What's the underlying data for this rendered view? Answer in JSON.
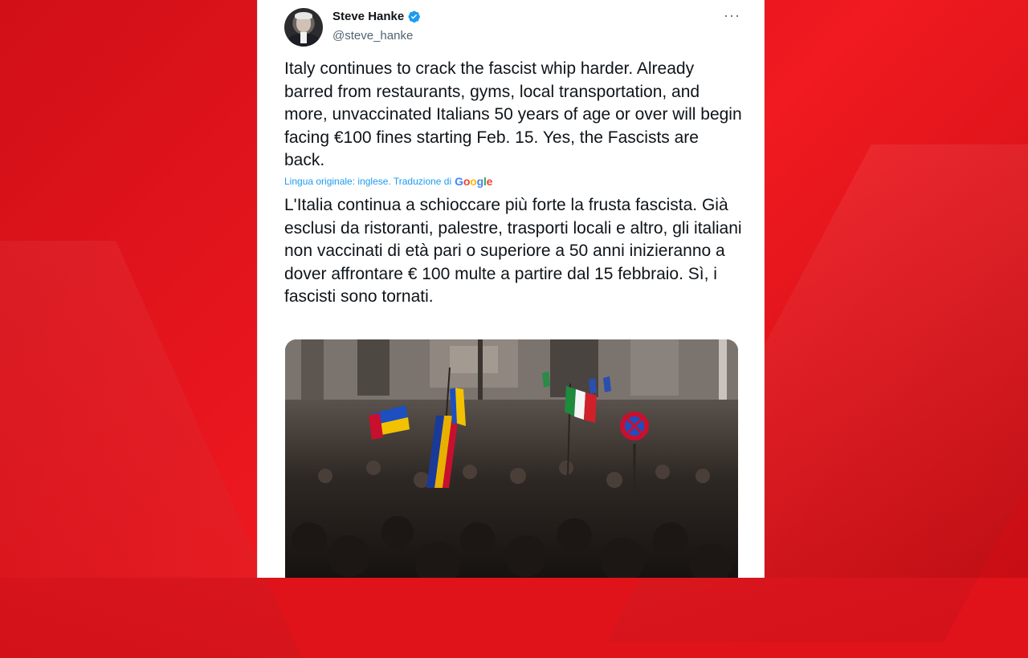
{
  "tweet": {
    "author_name": "Steve Hanke",
    "author_handle": "@steve_hanke",
    "more_label": "···",
    "text": "Italy continues to crack the fascist whip harder. Already barred from restaurants, gyms, local transportation, and more, unvaccinated Italians 50 years of age or over will begin facing €100 fines starting Feb. 15. Yes, the Fascists are back.",
    "translation_notice": "Lingua originale: inglese. Traduzione di",
    "translation_provider": [
      "G",
      "o",
      "o",
      "g",
      "l",
      "e"
    ],
    "translated_text": "L'Italia continua a schioccare più forte la frusta fascista. Già esclusi da ristoranti, palestre, trasporti locali e altro, gli italiani non vaccinati di età pari o superiore a 50 anni inizieranno a dover affrontare € 100 multe a partire dal 15 febbraio. Sì, i fascisti sono tornati."
  },
  "colors": {
    "background_red": "#e0121a",
    "link_blue": "#1d9bf0",
    "verified_blue": "#1d9bf0"
  },
  "icons": {
    "verified": "verified-badge-icon",
    "more": "more-options-icon"
  }
}
